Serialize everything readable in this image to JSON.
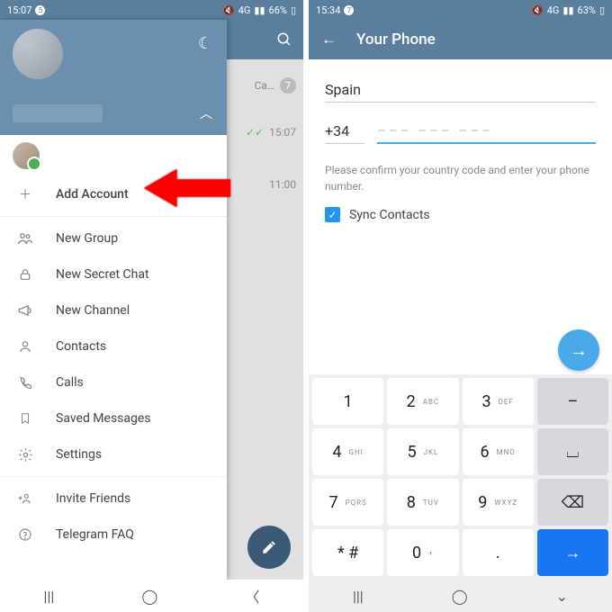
{
  "left": {
    "status": {
      "time": "15:07",
      "badge": "5",
      "net": "4G",
      "battery": "66%"
    },
    "chats": [
      {
        "name": "Ca…",
        "badge": "7"
      },
      {
        "time": "15:07",
        "checks": true
      },
      {
        "time": "11:00"
      }
    ],
    "drawer": {
      "account": {
        "add": "Add Account"
      },
      "items": [
        {
          "icon": "users",
          "label": "New Group"
        },
        {
          "icon": "lock",
          "label": "New Secret Chat"
        },
        {
          "icon": "megaphone",
          "label": "New Channel"
        },
        {
          "icon": "contact",
          "label": "Contacts"
        },
        {
          "icon": "phone",
          "label": "Calls"
        },
        {
          "icon": "bookmark",
          "label": "Saved Messages"
        },
        {
          "icon": "gear",
          "label": "Settings"
        }
      ],
      "footer": [
        {
          "icon": "invite",
          "label": "Invite Friends"
        },
        {
          "icon": "help",
          "label": "Telegram FAQ"
        }
      ]
    }
  },
  "right": {
    "status": {
      "time": "15:34",
      "badge": "7",
      "net": "4G",
      "battery": "63%"
    },
    "title": "Your Phone",
    "country": "Spain",
    "code": "+34",
    "placeholder": "––– –––  –––",
    "hint": "Please confirm your country code and enter your phone number.",
    "sync": "Sync Contacts",
    "keys": [
      {
        "n": "1",
        "s": ""
      },
      {
        "n": "2",
        "s": "ABC"
      },
      {
        "n": "3",
        "s": "DEF"
      },
      {
        "n": "–",
        "util": true
      },
      {
        "n": "4",
        "s": "GHI"
      },
      {
        "n": "5",
        "s": "JKL"
      },
      {
        "n": "6",
        "s": "MNO"
      },
      {
        "n": "⌴",
        "util": true
      },
      {
        "n": "7",
        "s": "PQRS"
      },
      {
        "n": "8",
        "s": "TUV"
      },
      {
        "n": "9",
        "s": "WXYZ"
      },
      {
        "n": "⌫",
        "util": true
      },
      {
        "n": "* #",
        "s": ""
      },
      {
        "n": "0",
        "s": "+"
      },
      {
        "n": ".",
        "s": ""
      },
      {
        "n": "→",
        "go": true
      }
    ]
  }
}
